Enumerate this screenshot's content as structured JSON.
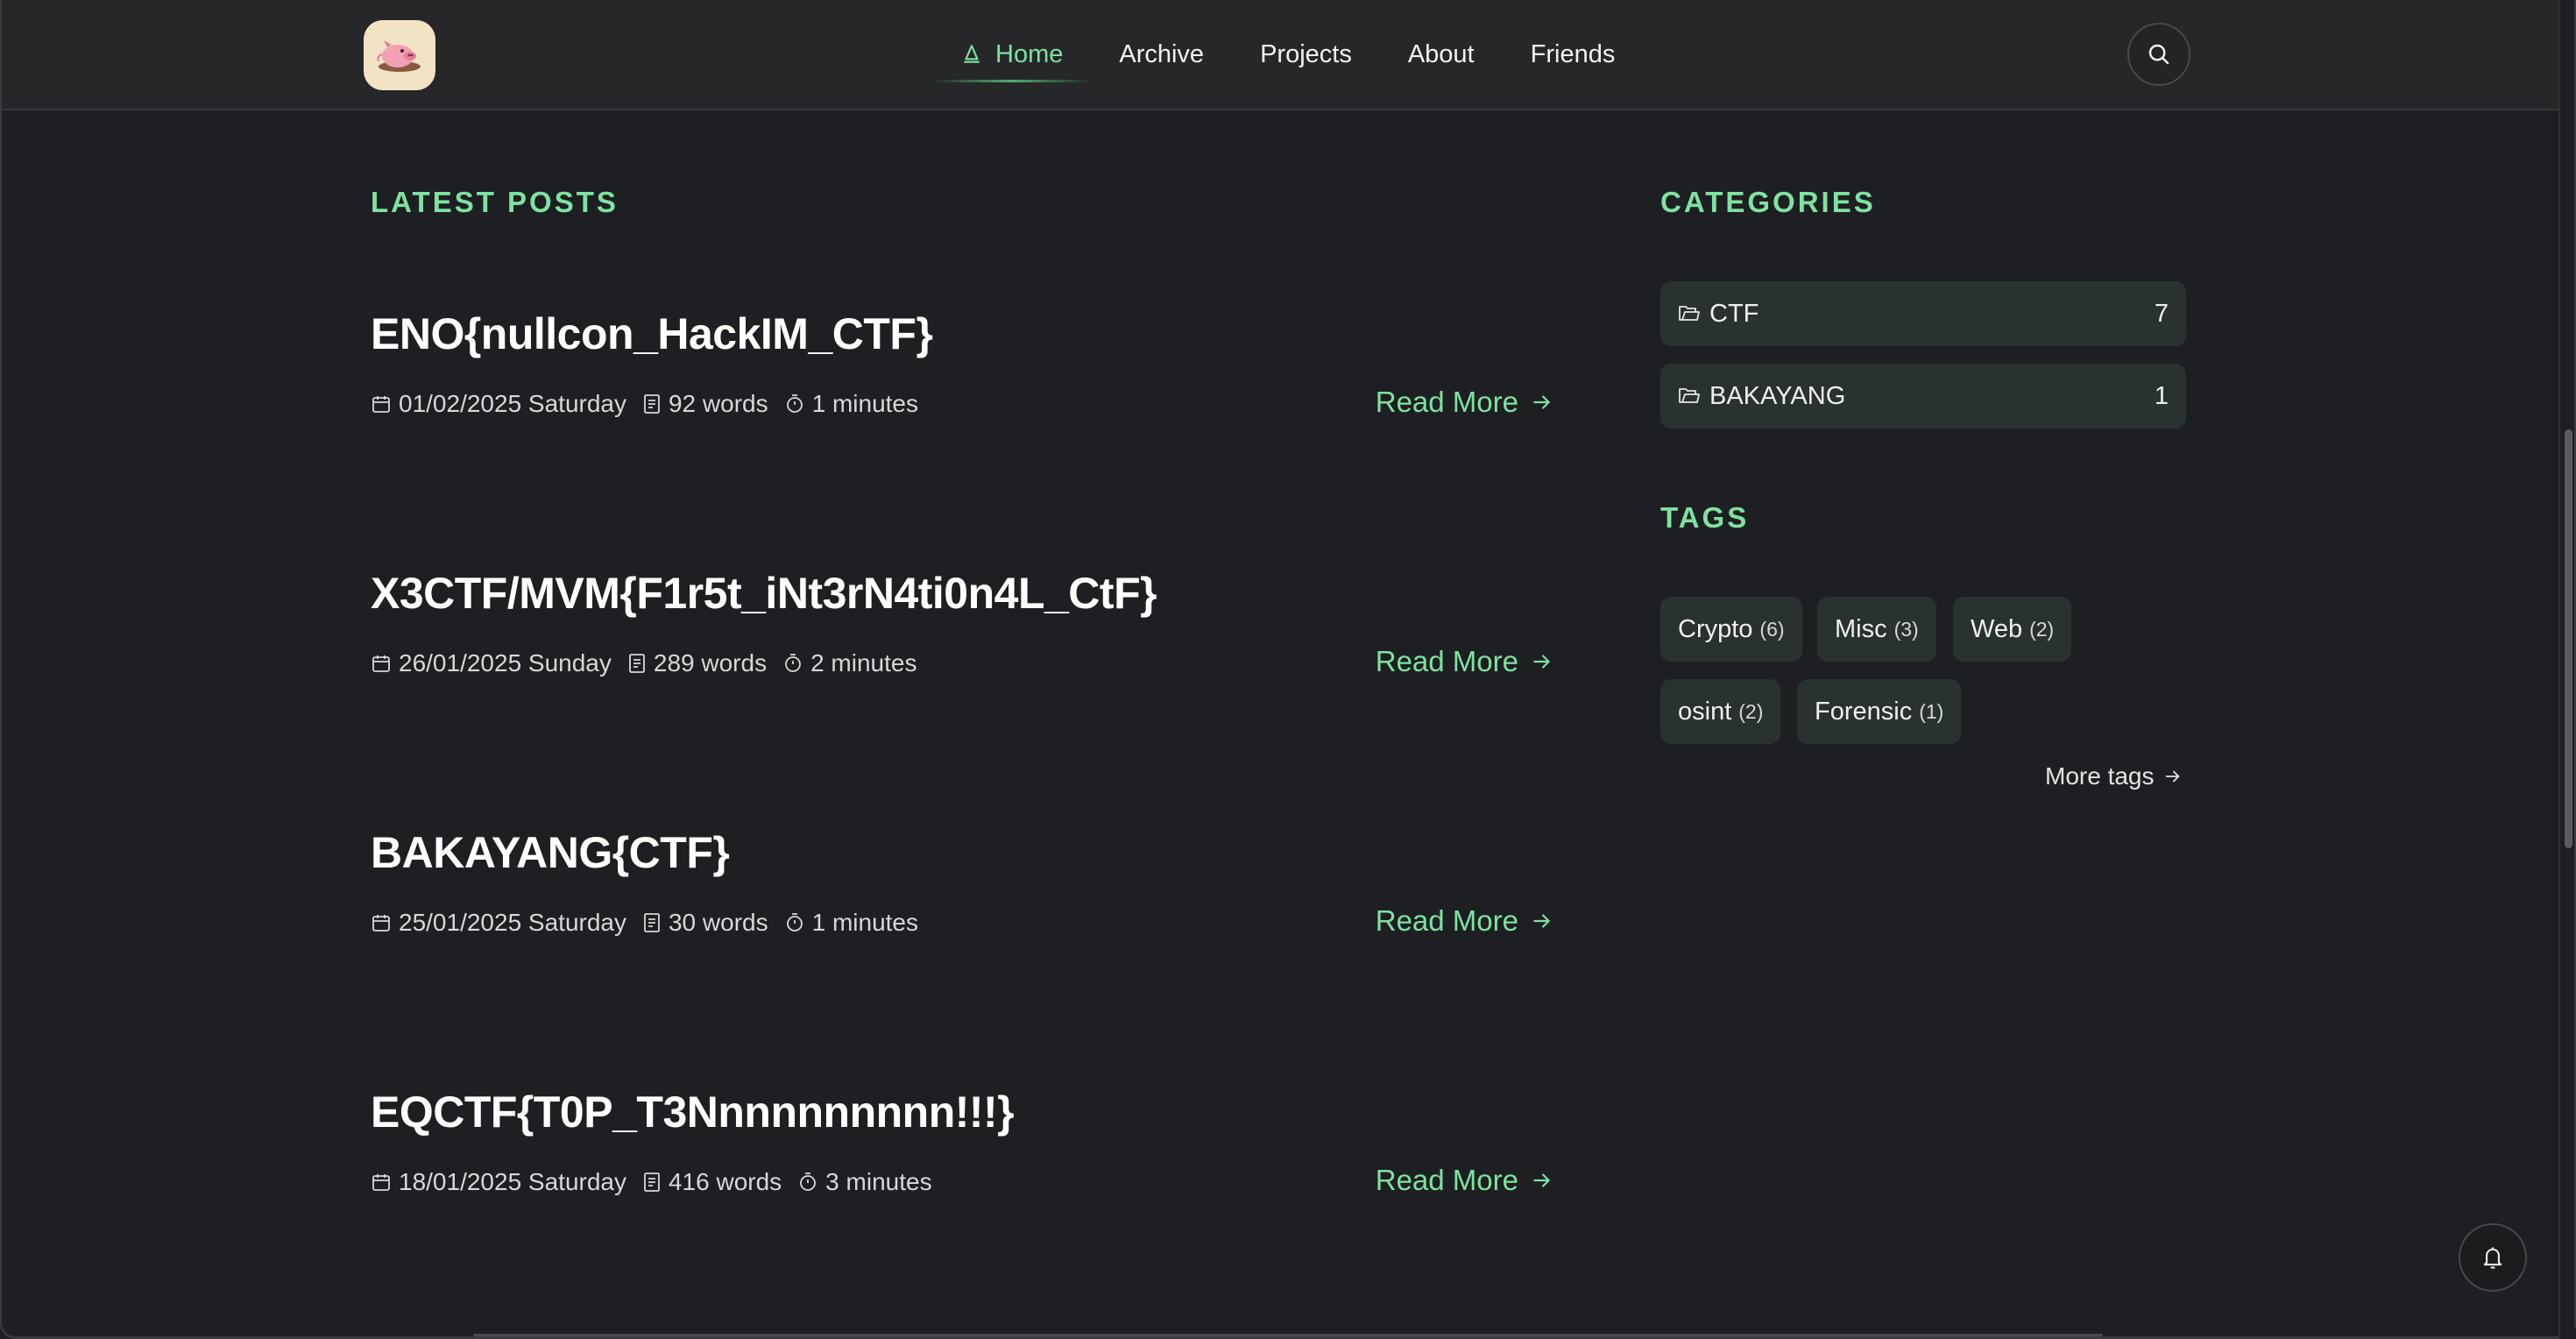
{
  "nav": {
    "items": [
      {
        "label": "Home",
        "active": true
      },
      {
        "label": "Archive"
      },
      {
        "label": "Projects"
      },
      {
        "label": "About"
      },
      {
        "label": "Friends"
      }
    ]
  },
  "icons": {
    "logo": "pig-avatar-icon",
    "home": "sailboat-icon",
    "search": "search-icon",
    "date": "calendar-icon",
    "words": "document-icon",
    "time": "stopwatch-icon",
    "arrow": "arrow-right-icon",
    "folder": "folder-icon",
    "bell": "bell-icon"
  },
  "colors": {
    "accent": "#7ee2a0",
    "background": "#1e1f22",
    "header": "#262729",
    "chip": "#2a3230"
  },
  "latest": {
    "title": "LATEST POSTS",
    "posts": [
      {
        "title": "ENO{nullcon_HackIM_CTF}",
        "date": "01/02/2025 Saturday",
        "words": "92 words",
        "time": "1 minutes",
        "read_more": "Read More"
      },
      {
        "title": "X3CTF/MVM{F1r5t_iNt3rN4ti0n4L_CtF}",
        "date": "26/01/2025 Sunday",
        "words": "289 words",
        "time": "2 minutes",
        "read_more": "Read More"
      },
      {
        "title": "BAKAYANG{CTF}",
        "date": "25/01/2025 Saturday",
        "words": "30 words",
        "time": "1 minutes",
        "read_more": "Read More"
      },
      {
        "title": "EQCTF{T0P_T3Nnnnnnnnnn!!!}",
        "date": "18/01/2025 Saturday",
        "words": "416 words",
        "time": "3 minutes",
        "read_more": "Read More"
      }
    ]
  },
  "categories": {
    "title": "CATEGORIES",
    "items": [
      {
        "name": "CTF",
        "count": "7"
      },
      {
        "name": "BAKAYANG",
        "count": "1"
      }
    ]
  },
  "tags": {
    "title": "TAGS",
    "items": [
      {
        "name": "Crypto",
        "count": "(6)"
      },
      {
        "name": "Misc",
        "count": "(3)"
      },
      {
        "name": "Web",
        "count": "(2)"
      },
      {
        "name": "osint",
        "count": "(2)"
      },
      {
        "name": "Forensic",
        "count": "(1)"
      }
    ],
    "more": "More tags"
  }
}
